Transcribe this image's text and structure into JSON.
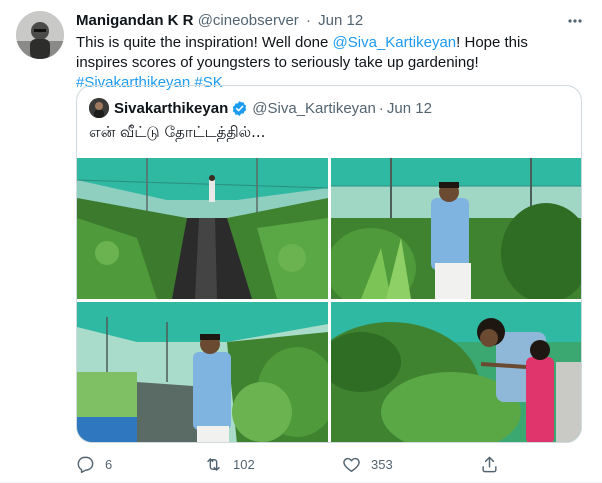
{
  "tweet": {
    "author_name": "Manigandan K R",
    "author_handle": "@cineobserver",
    "separator": "·",
    "date": "Jun 12",
    "text_parts": {
      "t1": "This is quite the inspiration! Well done ",
      "mention": "@Siva_Kartikeyan",
      "t2": "! Hope this inspires scores of youngsters to seriously take up gardening! ",
      "hashtag1": "#Sivakarthikeyan",
      "space": " ",
      "hashtag2": "#SK"
    }
  },
  "quoted_tweet": {
    "author_name": "Sivakarthikeyan",
    "author_handle": "@Siva_Kartikeyan",
    "separator": "·",
    "date": "Jun 12",
    "text": "என் வீட்டு தோட்டத்தில்...",
    "photos": [
      "greenhouse-rows",
      "man-in-garden-1",
      "man-in-greenhouse",
      "man-and-child-in-plants"
    ]
  },
  "actions": {
    "replies": "6",
    "retweets": "102",
    "likes": "353"
  },
  "icons": [
    "more-icon",
    "verified-icon",
    "reply-icon",
    "retweet-icon",
    "like-icon",
    "share-icon"
  ],
  "colors": {
    "link": "#1d9bf0",
    "secondary_text": "#536471",
    "border": "#cfd9de",
    "net_teal": "#2fb8a2",
    "foliage": "#3c7a2e"
  }
}
